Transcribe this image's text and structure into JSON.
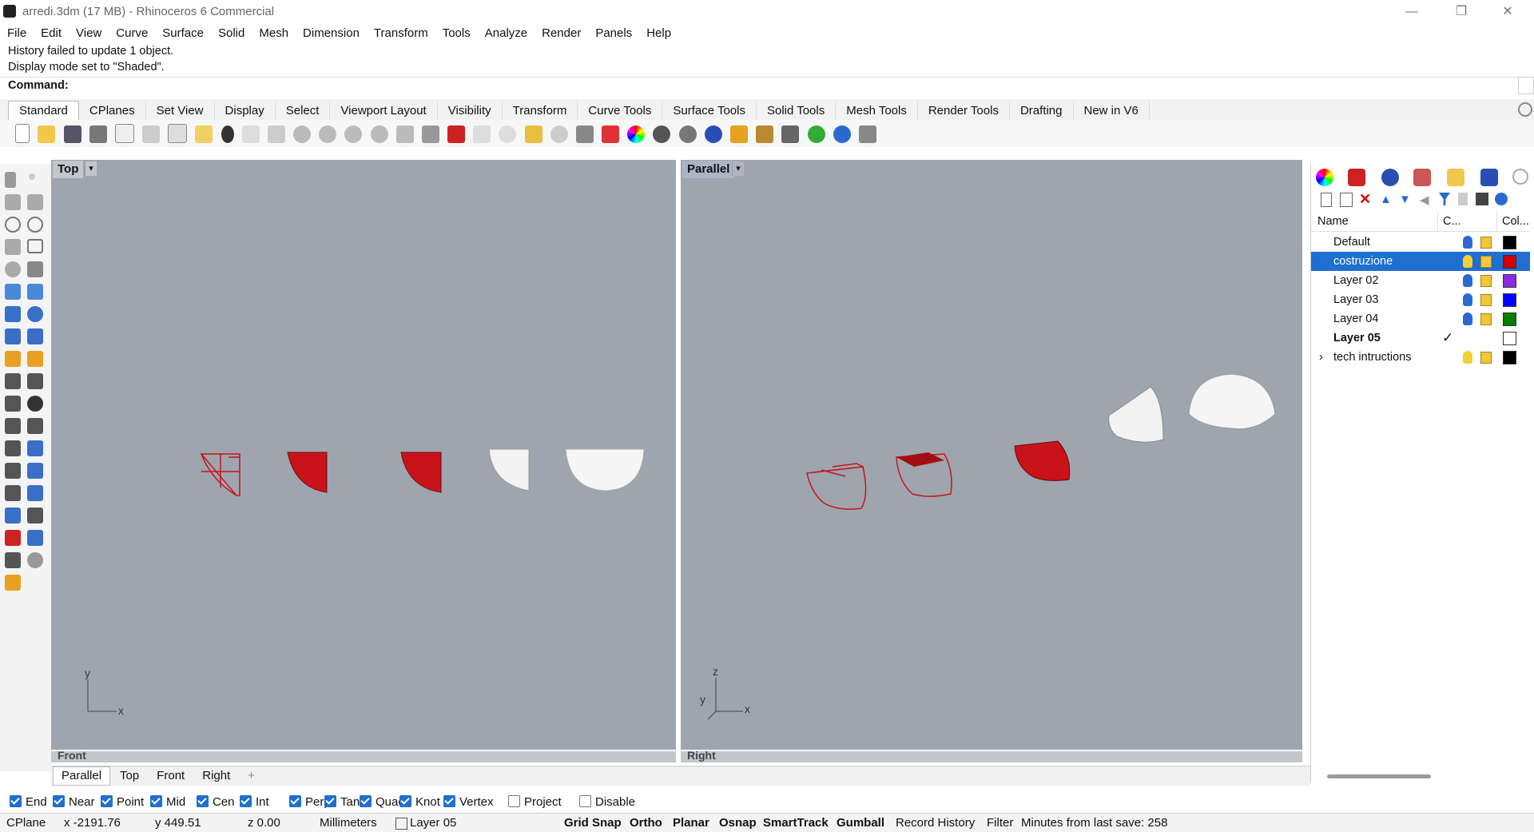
{
  "window": {
    "title": "arredi.3dm (17 MB) - Rhinoceros 6 Commercial",
    "minimize": "—",
    "maximize": "❐",
    "close": "✕"
  },
  "menu": [
    "File",
    "Edit",
    "View",
    "Curve",
    "Surface",
    "Solid",
    "Mesh",
    "Dimension",
    "Transform",
    "Tools",
    "Analyze",
    "Render",
    "Panels",
    "Help"
  ],
  "history": {
    "line1": "History failed to update 1 object.",
    "line2": "Display mode set to \"Shaded\"."
  },
  "command": {
    "label": "Command:"
  },
  "toolbar_tabs": [
    "Standard",
    "CPlanes",
    "Set View",
    "Display",
    "Select",
    "Viewport Layout",
    "Visibility",
    "Transform",
    "Curve Tools",
    "Surface Tools",
    "Solid Tools",
    "Mesh Tools",
    "Render Tools",
    "Drafting",
    "New in V6"
  ],
  "viewports": {
    "left": {
      "title": "Top",
      "bottom_label": "Front",
      "axis_x": "x",
      "axis_y": "y"
    },
    "right": {
      "title": "Parallel",
      "bottom_label": "Right",
      "axis_x": "x",
      "axis_y": "y",
      "axis_z": "z"
    }
  },
  "layers": {
    "headers": {
      "name": "Name",
      "current": "C...",
      "color": "Col..."
    },
    "rows": [
      {
        "name": "Default",
        "color": "#000000",
        "selected": false,
        "current": false
      },
      {
        "name": "costruzione",
        "color": "#d40000",
        "selected": true,
        "current": false
      },
      {
        "name": "Layer 02",
        "color": "#8a2be2",
        "selected": false,
        "current": false
      },
      {
        "name": "Layer 03",
        "color": "#0000ff",
        "selected": false,
        "current": false
      },
      {
        "name": "Layer 04",
        "color": "#008000",
        "selected": false,
        "current": false
      },
      {
        "name": "Layer 05",
        "color": "#ffffff",
        "selected": false,
        "current": true,
        "checkmark": "✓"
      },
      {
        "name": "tech intructions",
        "color": "#000000",
        "selected": false,
        "current": false,
        "expander": "›"
      }
    ]
  },
  "viewport_tabs": [
    "Parallel",
    "Top",
    "Front",
    "Right"
  ],
  "viewport_tab_add": "+",
  "osnaps": [
    {
      "label": "End",
      "on": true
    },
    {
      "label": "Near",
      "on": true
    },
    {
      "label": "Point",
      "on": true
    },
    {
      "label": "Mid",
      "on": true
    },
    {
      "label": "Cen",
      "on": true
    },
    {
      "label": "Int",
      "on": true
    },
    {
      "label": "Perp",
      "on": true
    },
    {
      "label": "Tan",
      "on": true
    },
    {
      "label": "Quad",
      "on": true
    },
    {
      "label": "Knot",
      "on": true
    },
    {
      "label": "Vertex",
      "on": true
    },
    {
      "label": "Project",
      "on": false
    },
    {
      "label": "Disable",
      "on": false
    }
  ],
  "status": {
    "cplane": "CPlane",
    "x": "x -2191.76",
    "y": "y 449.51",
    "z": "z 0.00",
    "units": "Millimeters",
    "layer": "Layer 05",
    "grid_snap": "Grid Snap",
    "ortho": "Ortho",
    "planar": "Planar",
    "osnap": "Osnap",
    "smarttrack": "SmartTrack",
    "gumball": "Gumball",
    "record_history": "Record History",
    "filter": "Filter",
    "minutes": "Minutes from last save: 258"
  },
  "colors": {
    "viewport_bg": "#9fa5ae",
    "selection": "#1f6fd0",
    "model_red": "#c8131a"
  }
}
